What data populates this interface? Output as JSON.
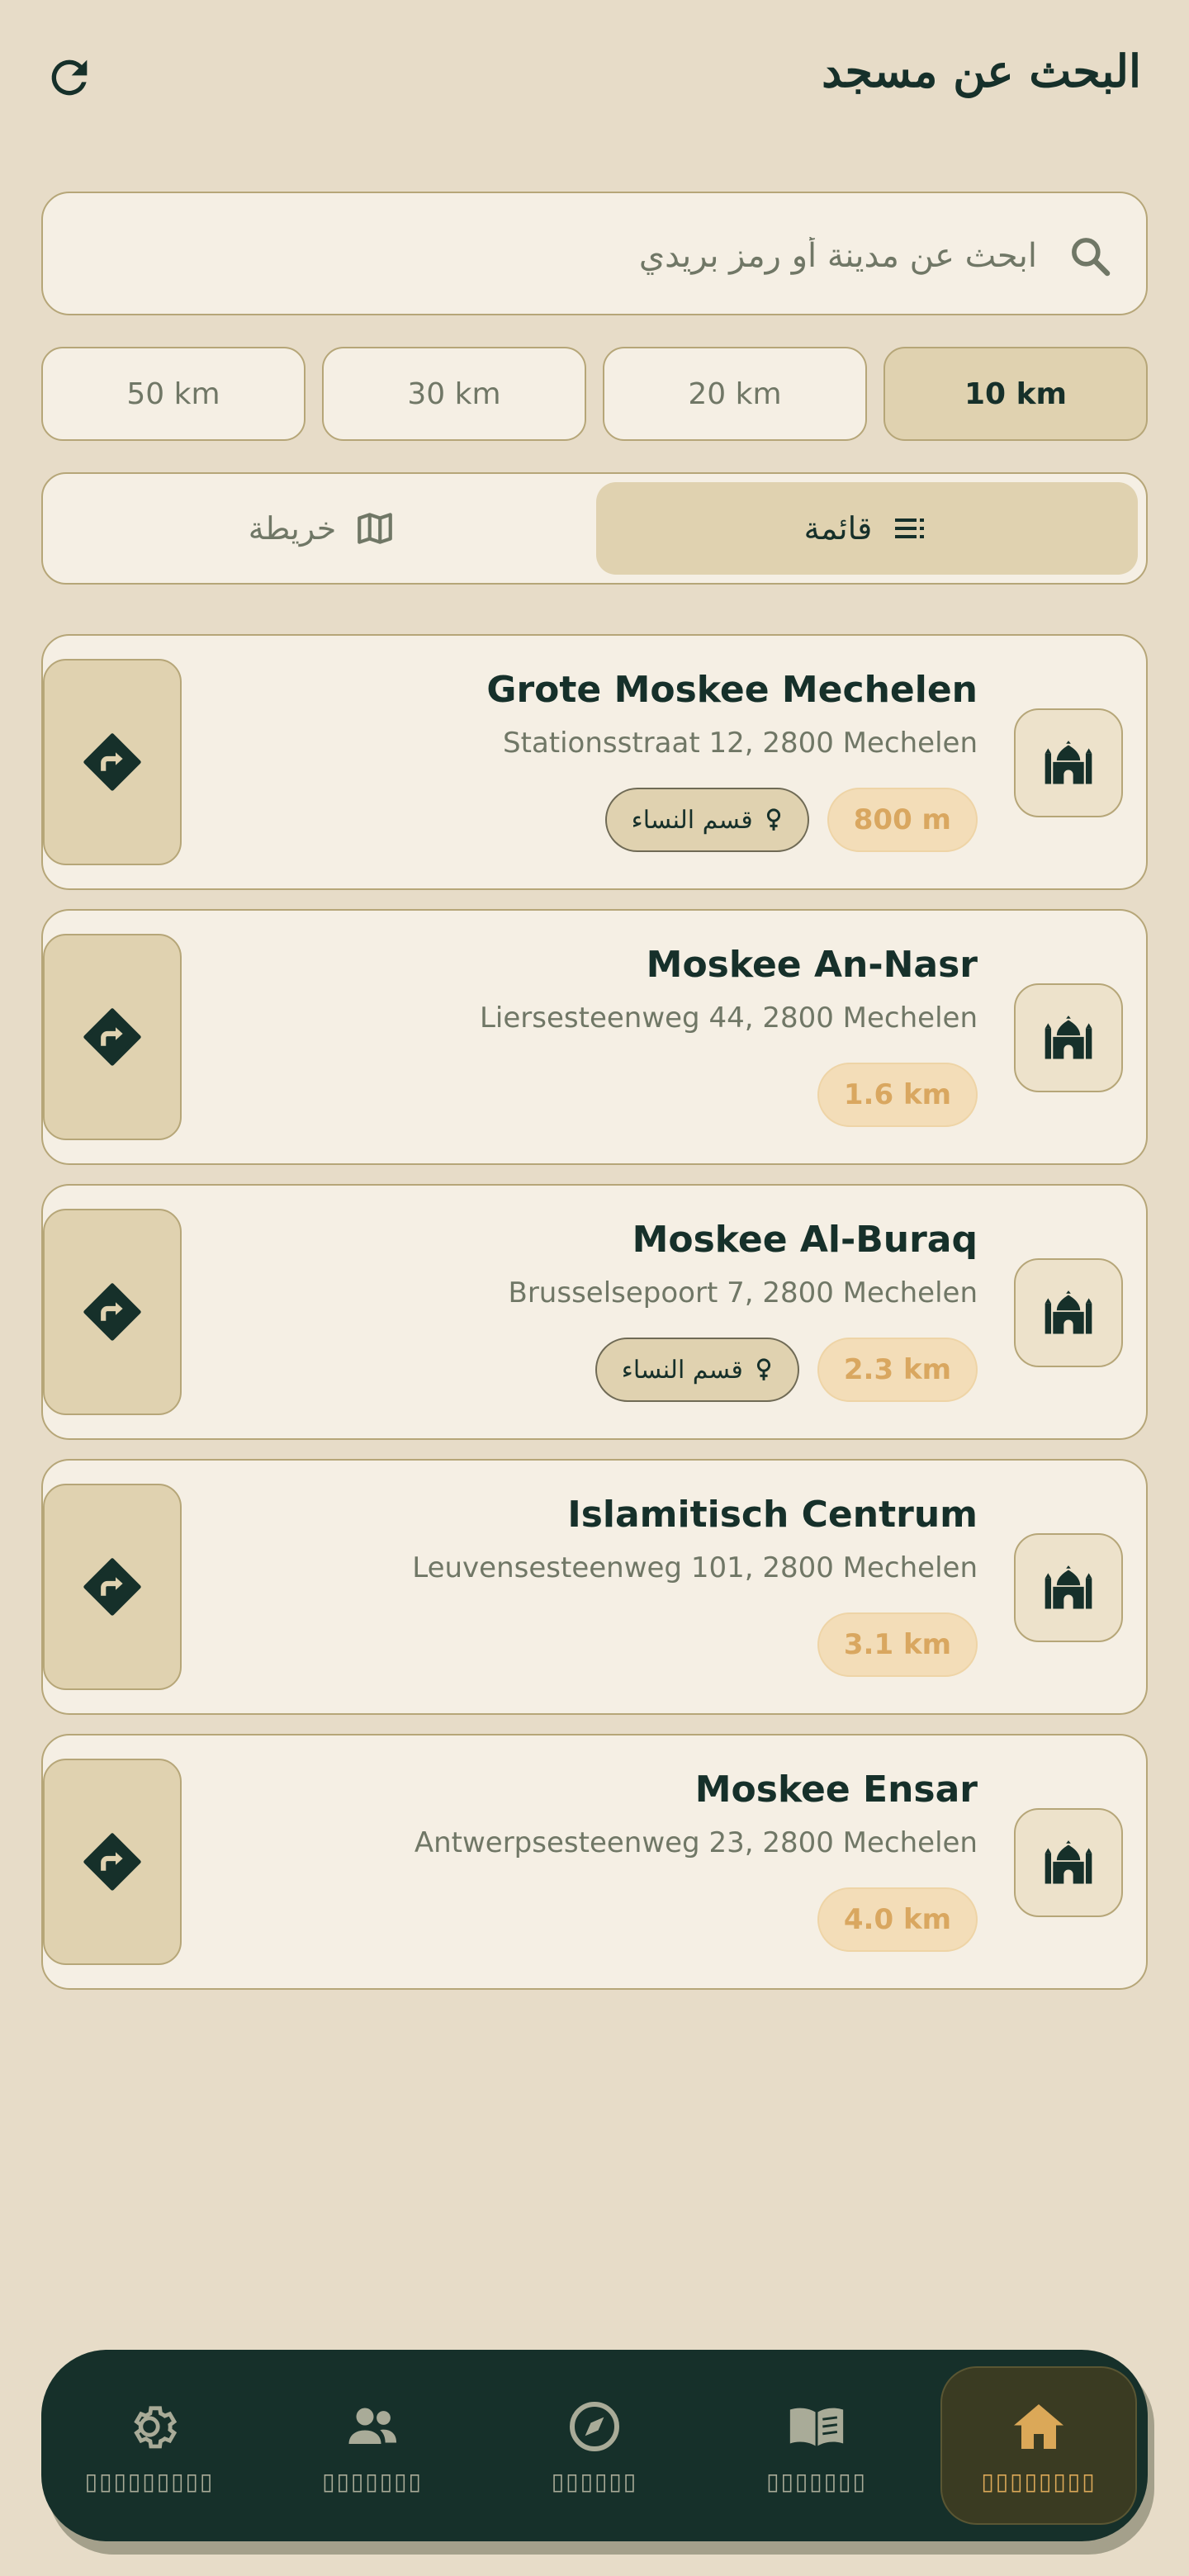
{
  "header": {
    "title": "البحث عن مسجد"
  },
  "search": {
    "placeholder": "ابحث عن مدينة أو رمز بريدي"
  },
  "radius_filters": [
    {
      "label": "10 km",
      "active": true
    },
    {
      "label": "20 km",
      "active": false
    },
    {
      "label": "30 km",
      "active": false
    },
    {
      "label": "50 km",
      "active": false
    }
  ],
  "view_toggle": {
    "list_label": "قائمة",
    "map_label": "خريطة",
    "active": "list"
  },
  "mosques": [
    {
      "name": "Grote Moskee Mechelen",
      "address": "Stationsstraat 12, 2800 Mechelen",
      "distance": "800 m",
      "women_section": "قسم النساء"
    },
    {
      "name": "Moskee An-Nasr",
      "address": "Liersesteenweg 44, 2800 Mechelen",
      "distance": "1.6 km",
      "women_section": ""
    },
    {
      "name": "Moskee Al-Buraq",
      "address": "Brusselsepoort 7, 2800 Mechelen",
      "distance": "2.3 km",
      "women_section": "قسم النساء"
    },
    {
      "name": "Islamitisch Centrum",
      "address": "Leuvensesteenweg 101, 2800 Mechelen",
      "distance": "3.1 km",
      "women_section": ""
    },
    {
      "name": "Moskee Ensar",
      "address": "Antwerpsesteenweg 23, 2800 Mechelen",
      "distance": "4.0 km",
      "women_section": ""
    }
  ],
  "bottom_nav": {
    "items": [
      {
        "icon": "gear-icon",
        "label": "▯▯▯▯▯▯▯▯▯"
      },
      {
        "icon": "people-icon",
        "label": "▯▯▯▯▯▯▯"
      },
      {
        "icon": "compass-icon",
        "label": "▯▯▯▯▯▯"
      },
      {
        "icon": "book-icon",
        "label": "▯▯▯▯▯▯▯"
      },
      {
        "icon": "home-icon",
        "label": "▯▯▯▯▯▯▯▯",
        "active": true
      }
    ]
  },
  "colors": {
    "background": "#e7dcc8",
    "card": "#f5efe4",
    "accent_dark": "#16302a",
    "accent_gold": "#dba858",
    "chip_active": "#e0d2b0"
  }
}
